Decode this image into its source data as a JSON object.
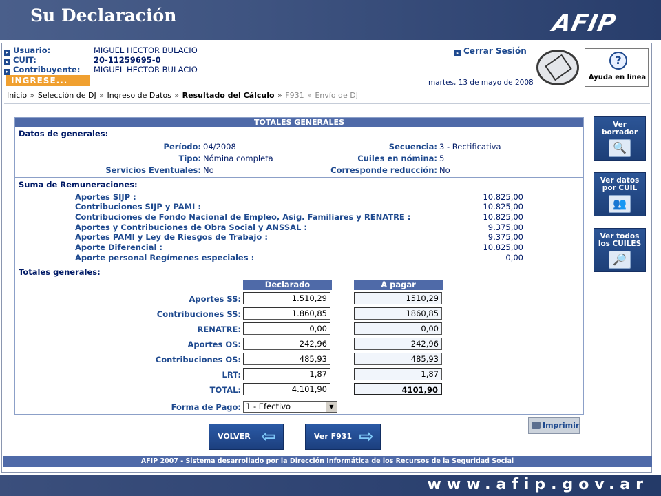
{
  "header": {
    "title": "Su Declaración",
    "logo": "AFIP"
  },
  "user": {
    "usuario_label": "Usuario:",
    "usuario": "MIGUEL HECTOR BULACIO",
    "cuit_label": "CUIT:",
    "cuit": "20-11259695-0",
    "contribuyente_label": "Contribuyente:",
    "contribuyente": "MIGUEL HECTOR BULACIO",
    "ingrese": "INGRESE..."
  },
  "session": {
    "cerrar": "Cerrar Sesión",
    "fecha": "martes, 13 de mayo de 2008"
  },
  "help": {
    "label": "Ayuda en línea"
  },
  "breadcrumb": [
    "Inicio",
    "Selección de DJ",
    "Ingreso de Datos",
    "Resultado del Cálculo",
    "F931",
    "Envío de DJ"
  ],
  "panel": {
    "title": "TOTALES GENERALES",
    "datos_title": "Datos de generales:",
    "periodo_label": "Período:",
    "periodo": "04/2008",
    "tipo_label": "Tipo:",
    "tipo": "Nómina completa",
    "servicios_label": "Servicios Eventuales:",
    "servicios": "No",
    "secuencia_label": "Secuencia:",
    "secuencia": "3 - Rectificativa",
    "cuiles_label": "Cuiles en nómina:",
    "cuiles": "5",
    "reduccion_label": "Corresponde reducción:",
    "reduccion": "No",
    "suma_title": "Suma de Remuneraciones:",
    "remuneraciones": [
      {
        "label": "Aportes SIJP :",
        "value": "10.825,00"
      },
      {
        "label": "Contribuciones SIJP y PAMI :",
        "value": "10.825,00"
      },
      {
        "label": "Contribuciones de Fondo Nacional de Empleo, Asig. Familiares y RENATRE :",
        "value": "10.825,00"
      },
      {
        "label": "Aportes y Contribuciones de Obra Social y ANSSAL :",
        "value": "9.375,00"
      },
      {
        "label": "Aportes PAMI y Ley de Riesgos de Trabajo :",
        "value": "9.375,00"
      },
      {
        "label": "Aporte Diferencial :",
        "value": "10.825,00"
      },
      {
        "label": "Aporte personal Regímenes especiales :",
        "value": "0,00"
      }
    ],
    "totales_title": "Totales generales:",
    "col_declarado": "Declarado",
    "col_apagar": "A pagar",
    "totales": [
      {
        "label": "Aportes SS:",
        "declarado": "1.510,29",
        "apagar": "1510,29"
      },
      {
        "label": "Contribuciones SS:",
        "declarado": "1.860,85",
        "apagar": "1860,85"
      },
      {
        "label": "RENATRE:",
        "declarado": "0,00",
        "apagar": "0,00"
      },
      {
        "label": "Aportes OS:",
        "declarado": "242,96",
        "apagar": "242,96"
      },
      {
        "label": "Contribuciones OS:",
        "declarado": "485,93",
        "apagar": "485,93"
      },
      {
        "label": "LRT:",
        "declarado": "1,87",
        "apagar": "1,87"
      },
      {
        "label": "TOTAL:",
        "declarado": "4.101,90",
        "apagar": "4101,90"
      }
    ],
    "forma_label": "Forma de Pago:",
    "forma_value": "1 - Efectivo"
  },
  "side_buttons": [
    {
      "label1": "Ver",
      "label2": "borrador",
      "icon": "magnifier-document-icon"
    },
    {
      "label1": "Ver datos",
      "label2": "por CUIL",
      "icon": "users-icon"
    },
    {
      "label1": "Ver todos",
      "label2": "los CUILES",
      "icon": "users-search-icon"
    }
  ],
  "actions": {
    "imprimir": "Imprimir",
    "volver": "VOLVER",
    "ver_f931": "Ver F931"
  },
  "footer": "AFIP 2007 - Sistema desarrollado por la Dirección Informática de los Recursos de la Seguridad Social",
  "url": "www.afip.gov.ar"
}
